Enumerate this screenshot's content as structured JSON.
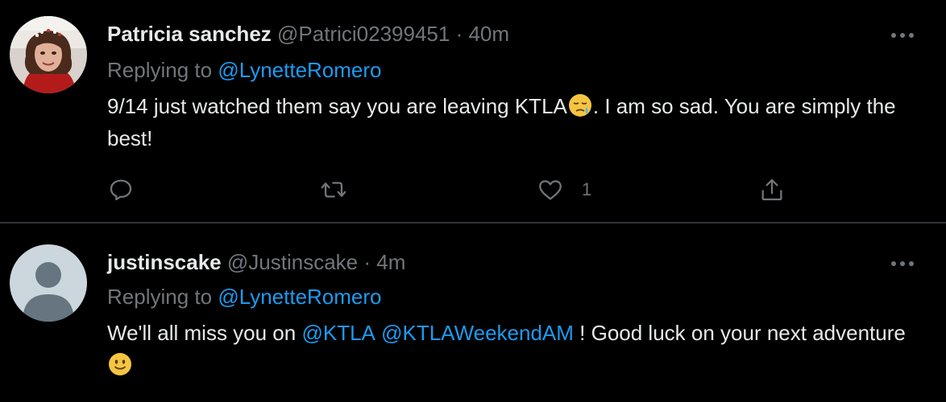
{
  "tweets": [
    {
      "name": "Patricia sanchez",
      "handle": "@Patrici02399451",
      "separator": "·",
      "time": "40m",
      "replying_prefix": "Replying to",
      "replying_to": "@LynetteRomero",
      "text_part1": "9/14 just watched them say you are leaving KTLA",
      "emoji": "sad-tear-emoji",
      "text_part2": ". I am so sad.  You are simply the best!",
      "actions": {
        "reply_icon": "reply-icon",
        "retweet_icon": "retweet-icon",
        "like_icon": "heart-icon",
        "like_count": "1",
        "share_icon": "share-icon"
      },
      "more_icon": "more-icon"
    },
    {
      "name": "justinscake",
      "handle": "@Justinscake",
      "separator": "·",
      "time": "4m",
      "replying_prefix": "Replying to",
      "replying_to": "@LynetteRomero",
      "text_part1": "We'll all miss you on ",
      "mention1": "@KTLA",
      "mention2": "@KTLAWeekendAM",
      "text_part2": " ! Good luck on your next adventure ",
      "emoji": "slight-smile-emoji",
      "more_icon": "more-icon"
    }
  ],
  "colors": {
    "background": "#000000",
    "text": "#e7e9ea",
    "secondary": "#71767b",
    "link": "#1d9bf0",
    "divider": "#2f3336"
  }
}
